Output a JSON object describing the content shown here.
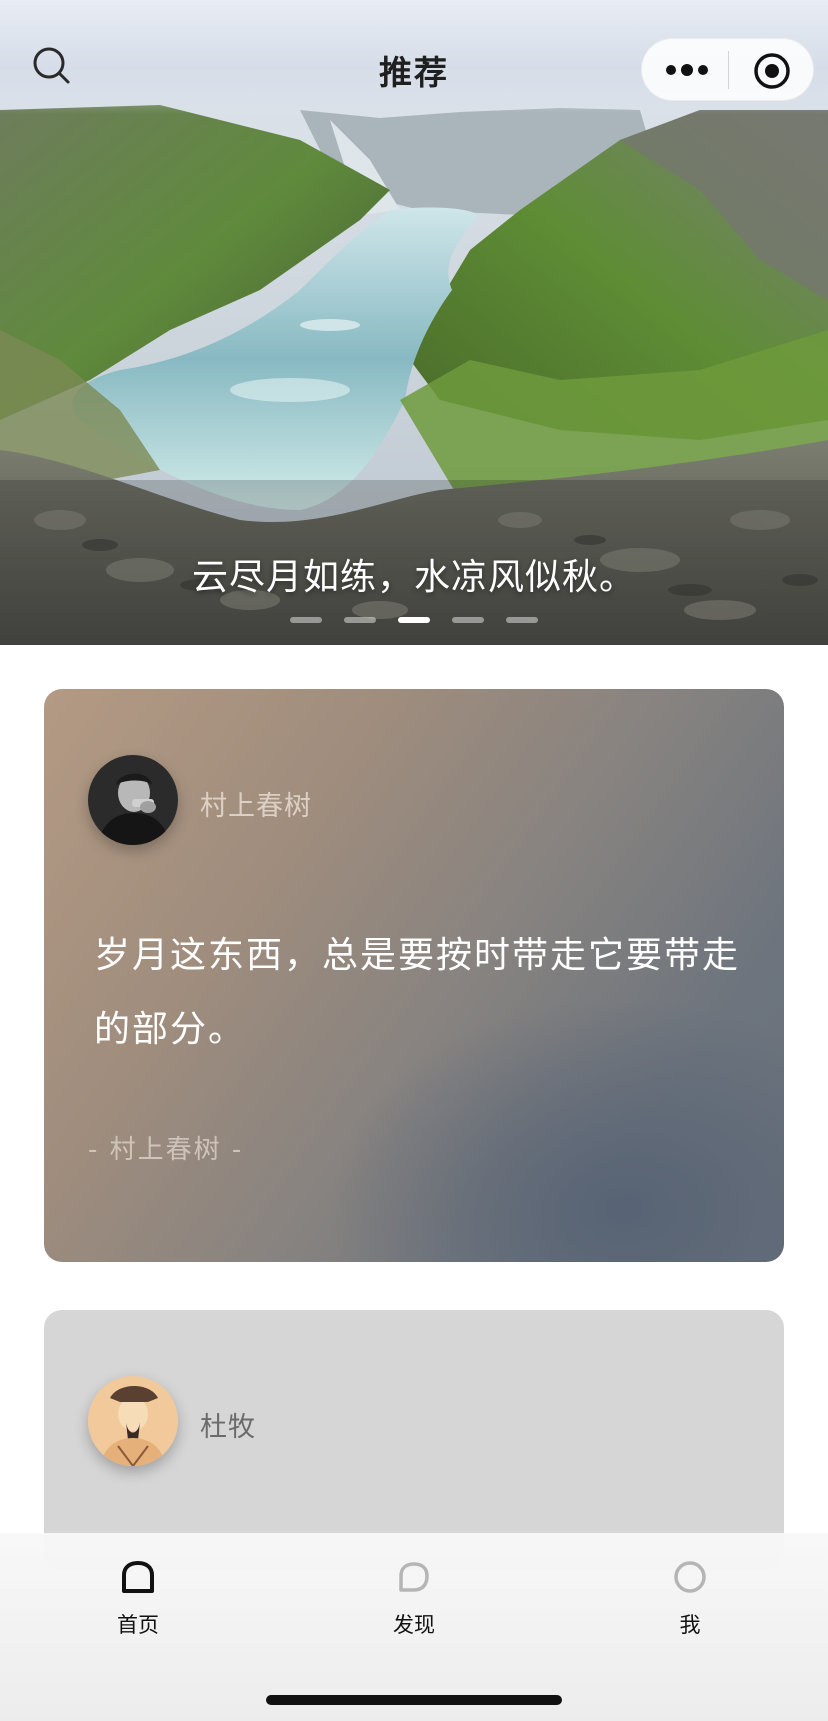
{
  "navbar": {
    "title": "推荐",
    "left_icon": "search-icon",
    "capsule_icons": [
      "more-dots-icon",
      "target-icon"
    ]
  },
  "hero": {
    "caption": "云尽月如练，水凉风似秋。",
    "slide_count": 5,
    "active_slide": 3
  },
  "cards": [
    {
      "author": "村上春树",
      "quote": "岁月这东西，总是要按时带走它要带走的部分。",
      "signature": "- 村上春树 -",
      "background": "#a08d7d"
    },
    {
      "author": "杜牧",
      "background": "#d6d6d6"
    }
  ],
  "tabbar": {
    "items": [
      {
        "label": "首页",
        "icon": "home-icon",
        "active": true
      },
      {
        "label": "发现",
        "icon": "discover-icon",
        "active": false
      },
      {
        "label": "我",
        "icon": "profile-icon",
        "active": false
      }
    ]
  },
  "colors": {
    "text_dark": "#1f1f1f",
    "tab_active": "#111111",
    "tab_inactive": "#b5b5b5"
  }
}
